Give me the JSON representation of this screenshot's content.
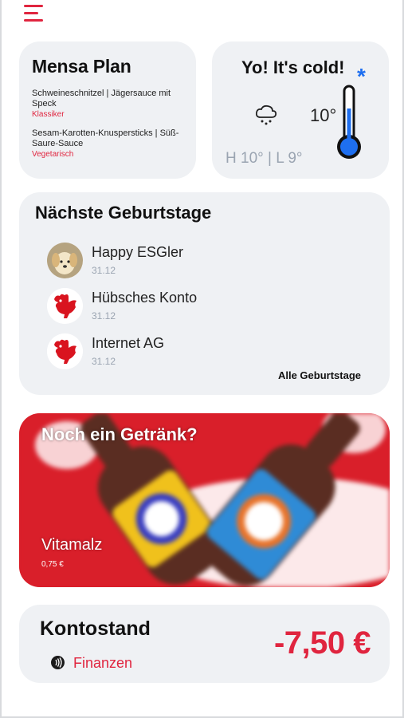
{
  "header": {
    "menu_icon": "hamburger-menu-icon"
  },
  "mensa": {
    "title": "Mensa Plan",
    "meals": [
      {
        "name": "Schweineschnitzel | Jägersauce mit Speck",
        "category": "Klassiker"
      },
      {
        "name": "Sesam-Karotten-Knuspersticks | Süß-Saure-Sauce",
        "category": "Vegetarisch"
      }
    ]
  },
  "weather": {
    "title": "Yo! It's cold!",
    "condition_icon": "cloud-snow-icon",
    "cold_icon": "snowflake-icon",
    "thermometer_icon": "thermometer-icon",
    "temperature": "10°",
    "high_low": "H 10° | L 9°"
  },
  "birthdays": {
    "title": "Nächste Geburtstage",
    "people": [
      {
        "name": "Happy ESGler",
        "date": "31.12",
        "avatar": "puppy-photo"
      },
      {
        "name": "Hübsches Konto",
        "date": "31.12",
        "avatar": "rooster-logo"
      },
      {
        "name": "Internet AG",
        "date": "31.12",
        "avatar": "rooster-logo"
      }
    ],
    "all_link": "Alle Geburtstage"
  },
  "drink": {
    "title": "Noch ein Getränk?",
    "name": "Vitamalz",
    "price": "0,75 €",
    "background_color": "#d91f2a"
  },
  "balance": {
    "title": "Kontostand",
    "link_label": "Finanzen",
    "link_icon": "contactless-icon",
    "amount": "-7,50 €"
  },
  "colors": {
    "accent": "#e0253f",
    "card": "#eff1f4",
    "muted": "#9aa4b1",
    "snow": "#1e6ff0"
  }
}
